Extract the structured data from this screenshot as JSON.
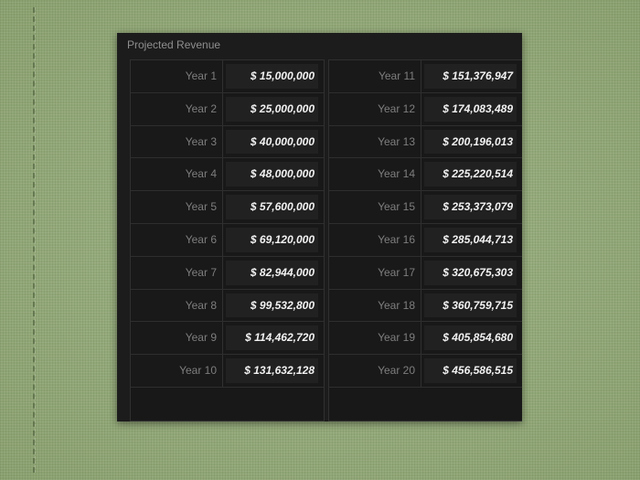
{
  "panel": {
    "title": "Projected Revenue"
  },
  "left_table": [
    {
      "label": "Year 1",
      "value": "$ 15,000,000"
    },
    {
      "label": "Year 2",
      "value": "$ 25,000,000"
    },
    {
      "label": "Year 3",
      "value": "$ 40,000,000"
    },
    {
      "label": "Year 4",
      "value": "$ 48,000,000"
    },
    {
      "label": "Year 5",
      "value": "$ 57,600,000"
    },
    {
      "label": "Year 6",
      "value": "$ 69,120,000"
    },
    {
      "label": "Year 7",
      "value": "$ 82,944,000"
    },
    {
      "label": "Year 8",
      "value": "$ 99,532,800"
    },
    {
      "label": "Year 9",
      "value": "$ 114,462,720"
    },
    {
      "label": "Year 10",
      "value": "$ 131,632,128"
    }
  ],
  "right_table": [
    {
      "label": "Year 11",
      "value": "$ 151,376,947"
    },
    {
      "label": "Year 12",
      "value": "$ 174,083,489"
    },
    {
      "label": "Year 13",
      "value": "$ 200,196,013"
    },
    {
      "label": "Year 14",
      "value": "$ 225,220,514"
    },
    {
      "label": "Year 15",
      "value": "$ 253,373,079"
    },
    {
      "label": "Year 16",
      "value": "$ 285,044,713"
    },
    {
      "label": "Year 17",
      "value": "$ 320,675,303"
    },
    {
      "label": "Year 18",
      "value": "$ 360,759,715"
    },
    {
      "label": "Year 19",
      "value": "$ 405,854,680"
    },
    {
      "label": "Year 20",
      "value": "$ 456,586,515"
    }
  ],
  "colors": {
    "background": "#93a87a",
    "panel": "#1c1c1c",
    "label_text": "#7e7e7e",
    "value_text": "#f2f2f2"
  }
}
